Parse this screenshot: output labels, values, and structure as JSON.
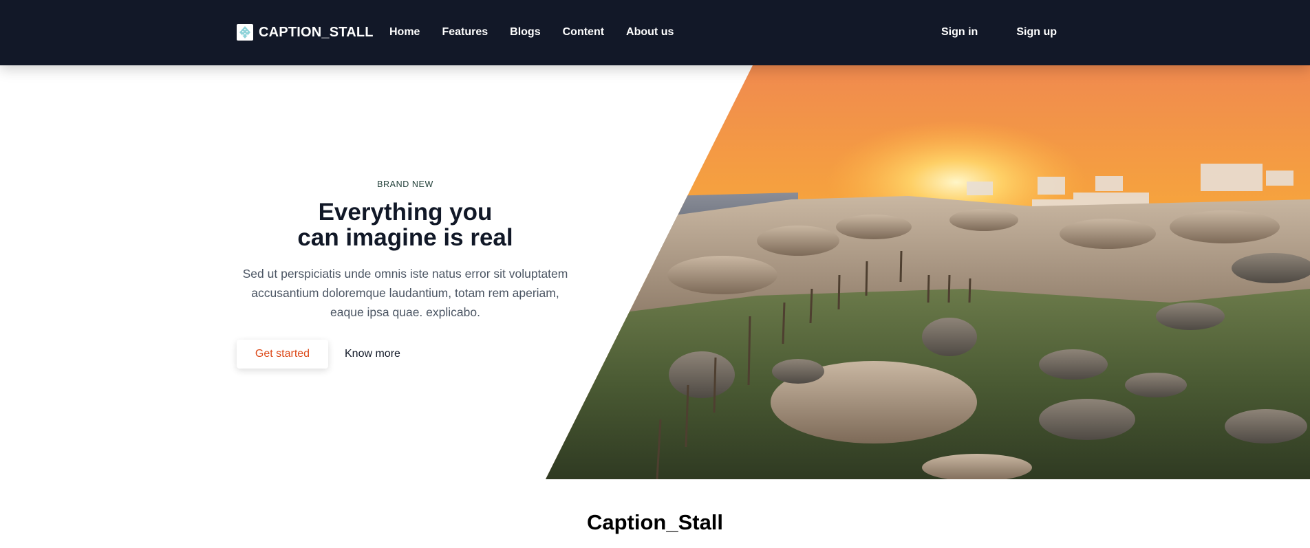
{
  "nav": {
    "brand": "CAPTION_STALL",
    "links": [
      "Home",
      "Features",
      "Blogs",
      "Content",
      "About us"
    ],
    "sign_in": "Sign in",
    "sign_up": "Sign up"
  },
  "hero": {
    "eyebrow": "BRAND NEW",
    "headline_line1": "Everything you",
    "headline_line2": "can imagine is real",
    "subtext": "Sed ut perspiciatis unde omnis iste natus error sit voluptatem accusantium doloremque laudantium, totam rem aperiam, eaque ipsa quae. explicabo.",
    "primary_cta": "Get started",
    "secondary_cta": "Know more",
    "image_icon": "sunset-coast-photo"
  },
  "section": {
    "title": "Caption_Stall"
  },
  "colors": {
    "nav_bg": "#121828",
    "accent": "#dc4a1a",
    "text_dark": "#111827",
    "text_muted": "#4b5563"
  }
}
